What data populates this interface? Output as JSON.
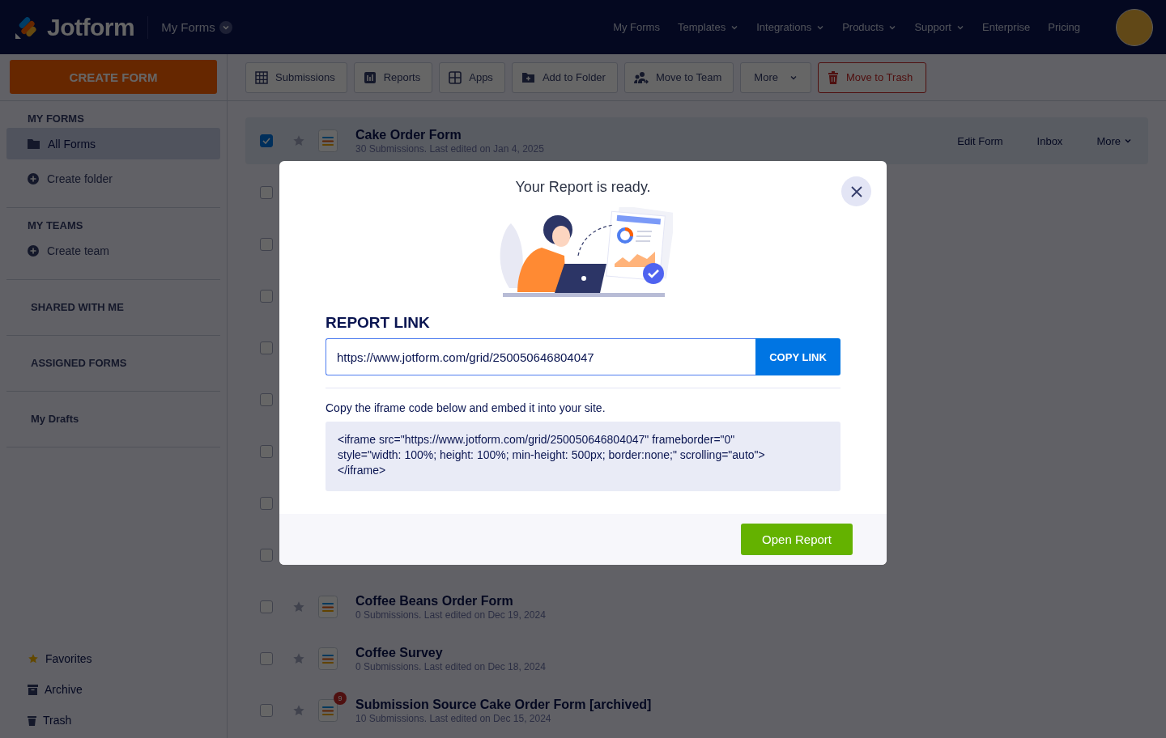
{
  "header": {
    "logo": "Jotform",
    "section": "My Forms",
    "nav": [
      {
        "label": "My Forms",
        "dropdown": false
      },
      {
        "label": "Templates",
        "dropdown": true
      },
      {
        "label": "Integrations",
        "dropdown": true
      },
      {
        "label": "Products",
        "dropdown": true
      },
      {
        "label": "Support",
        "dropdown": true
      },
      {
        "label": "Enterprise",
        "dropdown": false
      },
      {
        "label": "Pricing",
        "dropdown": false
      }
    ]
  },
  "create_button": "CREATE FORM",
  "sidebar": {
    "sections": [
      {
        "heading": "MY FORMS",
        "items": [
          {
            "label": "All Forms",
            "kind": "folder",
            "selected": true
          },
          {
            "label": "Create folder",
            "kind": "add",
            "selected": false
          }
        ]
      },
      {
        "heading": "MY TEAMS",
        "items": [
          {
            "label": "Create team",
            "kind": "add",
            "selected": false
          }
        ]
      },
      {
        "heading": "SHARED WITH ME"
      },
      {
        "heading": "ASSIGNED FORMS"
      },
      {
        "heading": "My Drafts"
      }
    ],
    "footer": [
      {
        "label": "Favorites",
        "kind": "star"
      },
      {
        "label": "Archive",
        "kind": "archive"
      },
      {
        "label": "Trash",
        "kind": "trash"
      }
    ]
  },
  "toolbar": [
    {
      "label": "Submissions",
      "kind": "grid"
    },
    {
      "label": "Reports",
      "kind": "chart"
    },
    {
      "label": "Apps",
      "kind": "apps"
    },
    {
      "label": "Add to Folder",
      "kind": "folder"
    },
    {
      "label": "Move to Team",
      "kind": "team"
    },
    {
      "label": "More",
      "kind": "dropdown"
    },
    {
      "label": "Move to Trash",
      "kind": "danger"
    }
  ],
  "forms": [
    {
      "title": "Cake Order Form",
      "meta": "30 Submissions. Last edited on Jan 4, 2025",
      "checked": true,
      "actions": [
        {
          "label": "Edit Form",
          "dropdown": false
        },
        {
          "label": "Inbox",
          "dropdown": false
        },
        {
          "label": "More",
          "dropdown": true
        }
      ]
    },
    {
      "checked": false
    },
    {
      "checked": false
    },
    {
      "checked": false
    },
    {
      "checked": false
    },
    {
      "checked": false
    },
    {
      "checked": false
    },
    {
      "checked": false
    },
    {
      "checked": false
    },
    {
      "title": "Coffee Beans Order Form",
      "meta": "0 Submissions. Last edited on Dec 19, 2024",
      "checked": false
    },
    {
      "title": "Coffee Survey",
      "meta": "0 Submissions. Last edited on Dec 18, 2024",
      "checked": false
    },
    {
      "title": "Submission Source Cake Order Form [archived]",
      "meta": "10 Submissions. Last edited on Dec 15, 2024",
      "checked": false,
      "badge": "9"
    }
  ],
  "modal": {
    "title": "Your Report is ready.",
    "link_heading": "REPORT LINK",
    "link": "https://www.jotform.com/grid/250050646804047",
    "copy_button": "COPY LINK",
    "embed_hint": "Copy the iframe code below and embed it into your site.",
    "embed_code": "<iframe src=\"https://www.jotform.com/grid/250050646804047\" frameborder=\"0\"\nstyle=\"width: 100%; height: 100%; min-height: 500px; border:none;\" scrolling=\"auto\">\n</iframe>",
    "open_button": "Open Report"
  }
}
